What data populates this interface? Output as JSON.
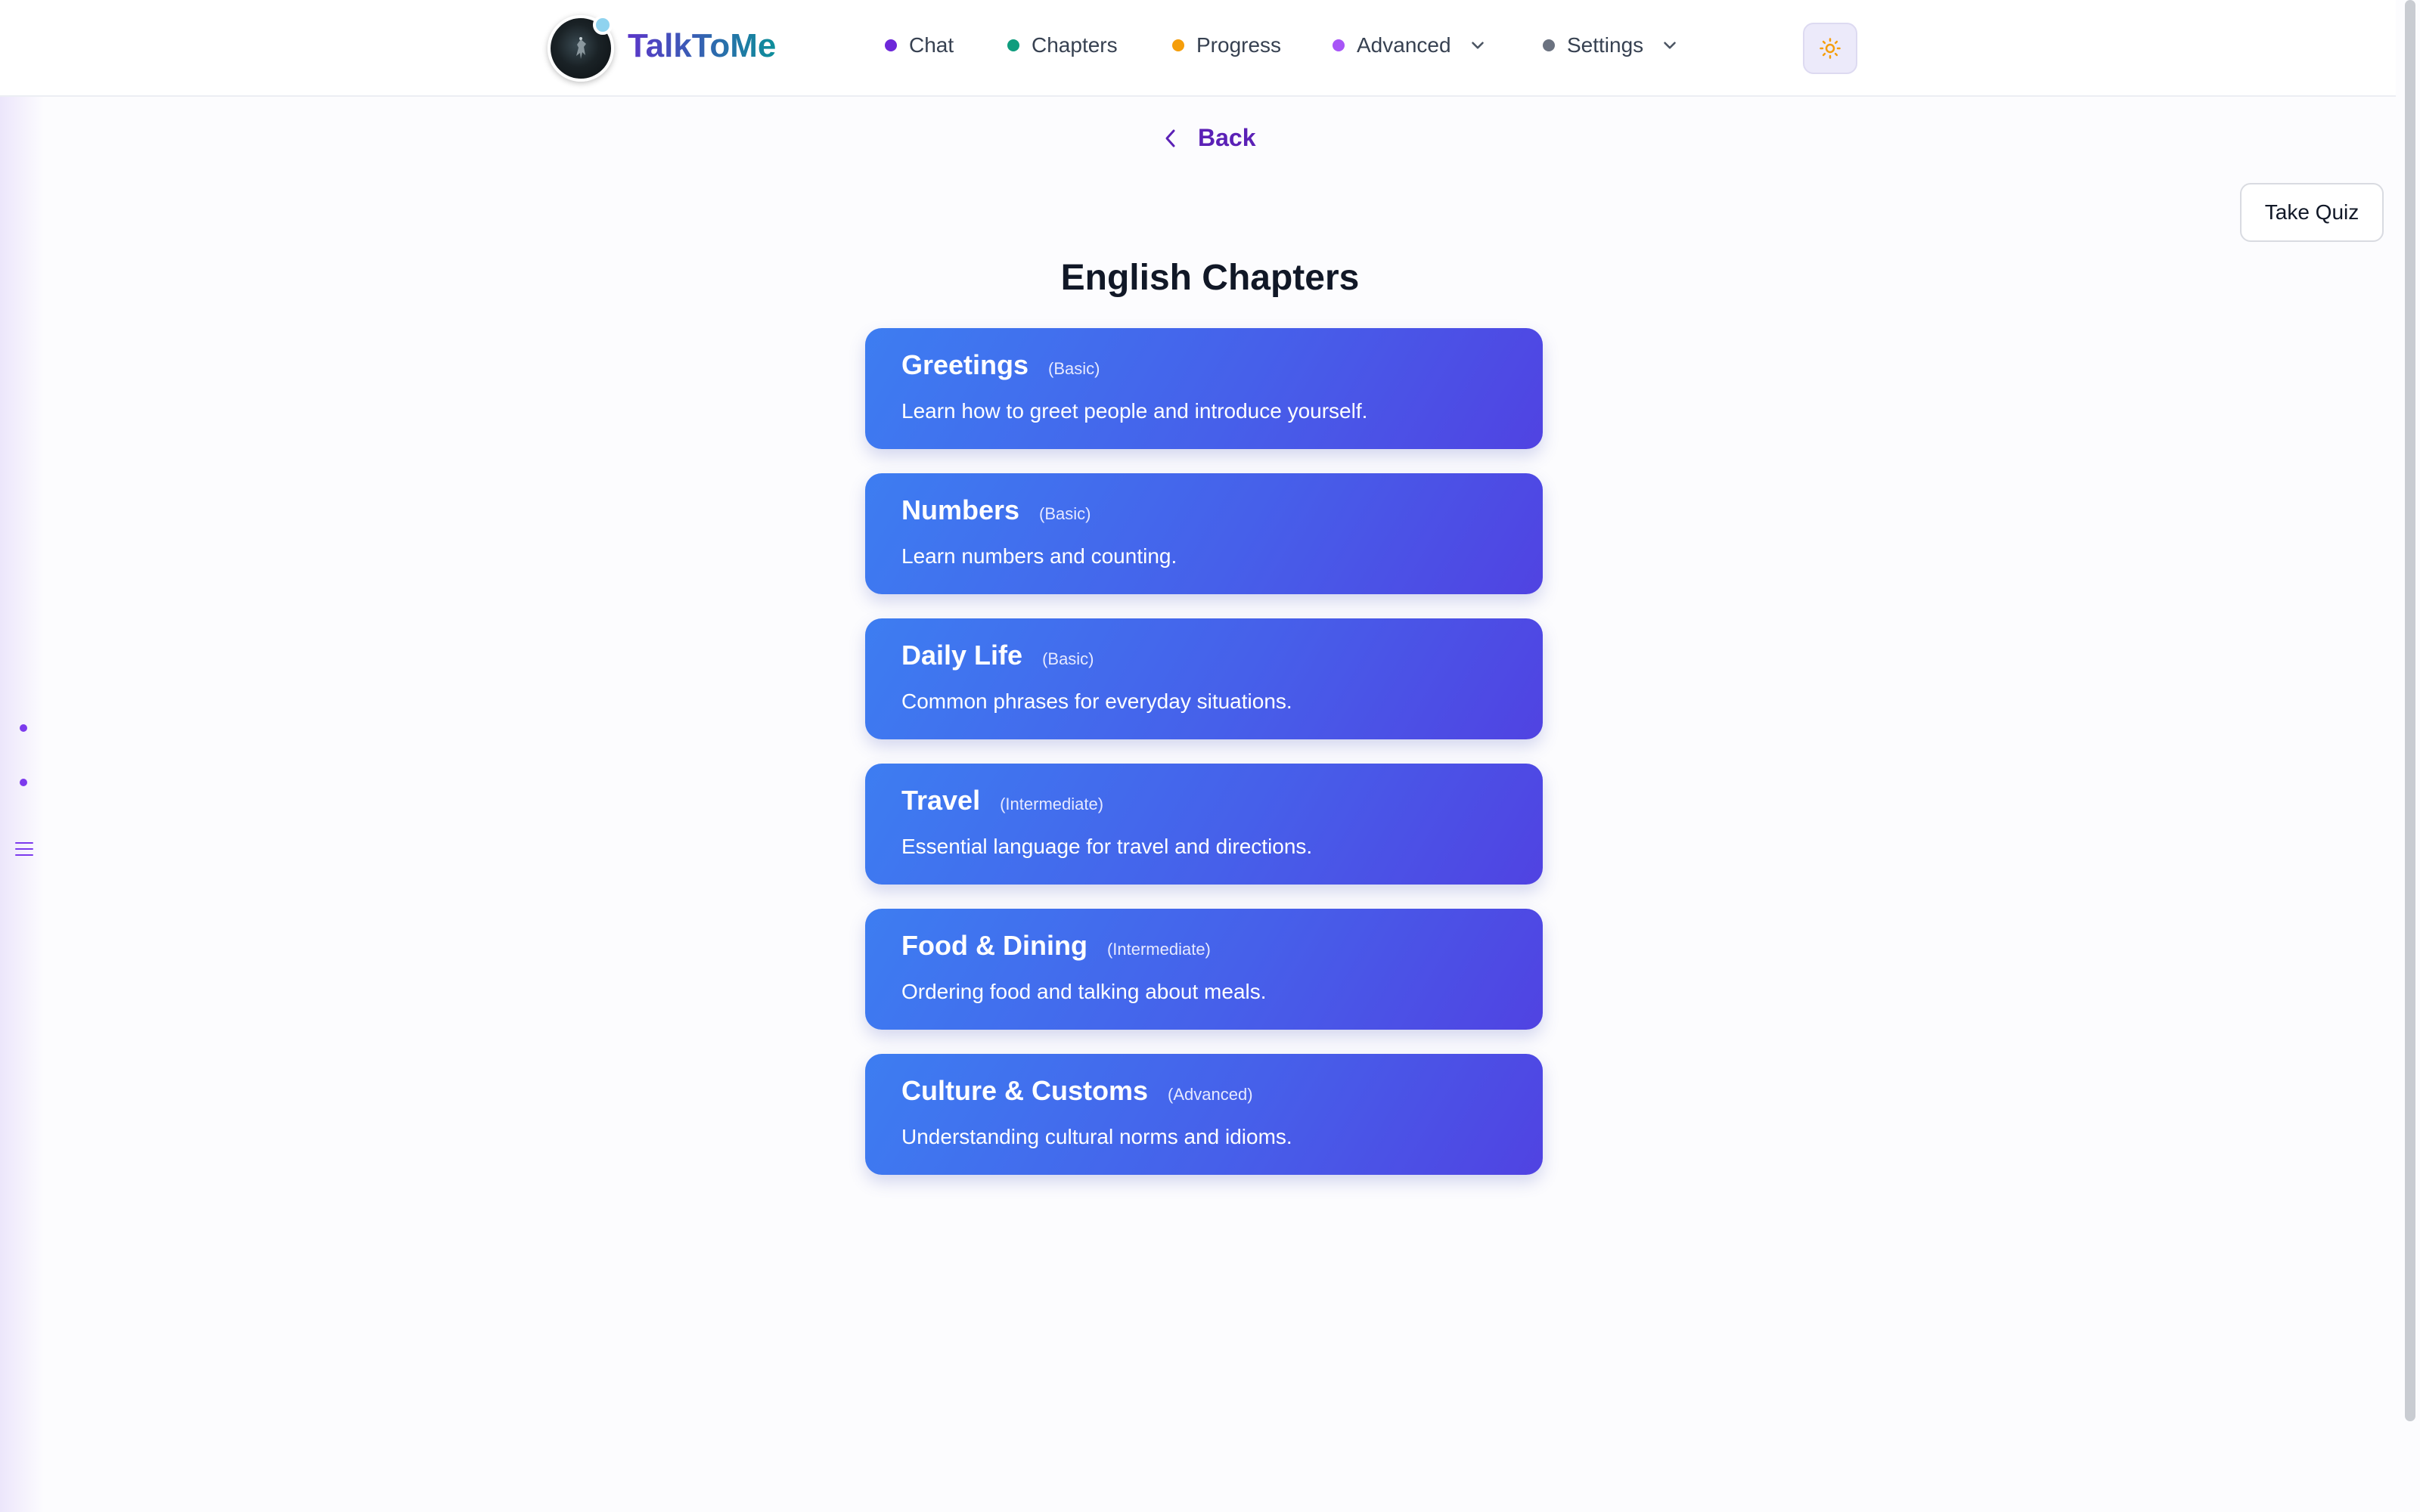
{
  "header": {
    "brand": "TalkToMe",
    "nav": [
      {
        "label": "Chat",
        "dot_color": "#6d28d9"
      },
      {
        "label": "Chapters",
        "dot_color": "#0f9d7e"
      },
      {
        "label": "Progress",
        "dot_color": "#f59e0b"
      },
      {
        "label": "Advanced",
        "dot_color": "#a855f7",
        "icon": "chevron-down-icon"
      },
      {
        "label": "Settings",
        "dot_color": "#6b7280",
        "icon": "chevron-down-icon"
      }
    ],
    "theme_icon": "sun-icon"
  },
  "back": {
    "label": "Back",
    "icon": "chevron-left-icon"
  },
  "quiz_button": {
    "label": "Take Quiz"
  },
  "page_title": "English Chapters",
  "chapters": [
    {
      "title": "Greetings",
      "level": "(Basic)",
      "description": "Learn how to greet people and introduce yourself."
    },
    {
      "title": "Numbers",
      "level": "(Basic)",
      "description": "Learn numbers and counting."
    },
    {
      "title": "Daily Life",
      "level": "(Basic)",
      "description": "Common phrases for everyday situations."
    },
    {
      "title": "Travel",
      "level": "(Intermediate)",
      "description": "Essential language for travel and directions."
    },
    {
      "title": "Food & Dining",
      "level": "(Intermediate)",
      "description": "Ordering food and talking about meals."
    },
    {
      "title": "Culture & Customs",
      "level": "(Advanced)",
      "description": "Understanding cultural norms and idioms."
    }
  ],
  "sidebar": {
    "icon": "menu-icon"
  },
  "colors": {
    "accent": "#5b21b6",
    "card_start": "#3d7df1",
    "card_end": "#5043e2"
  }
}
